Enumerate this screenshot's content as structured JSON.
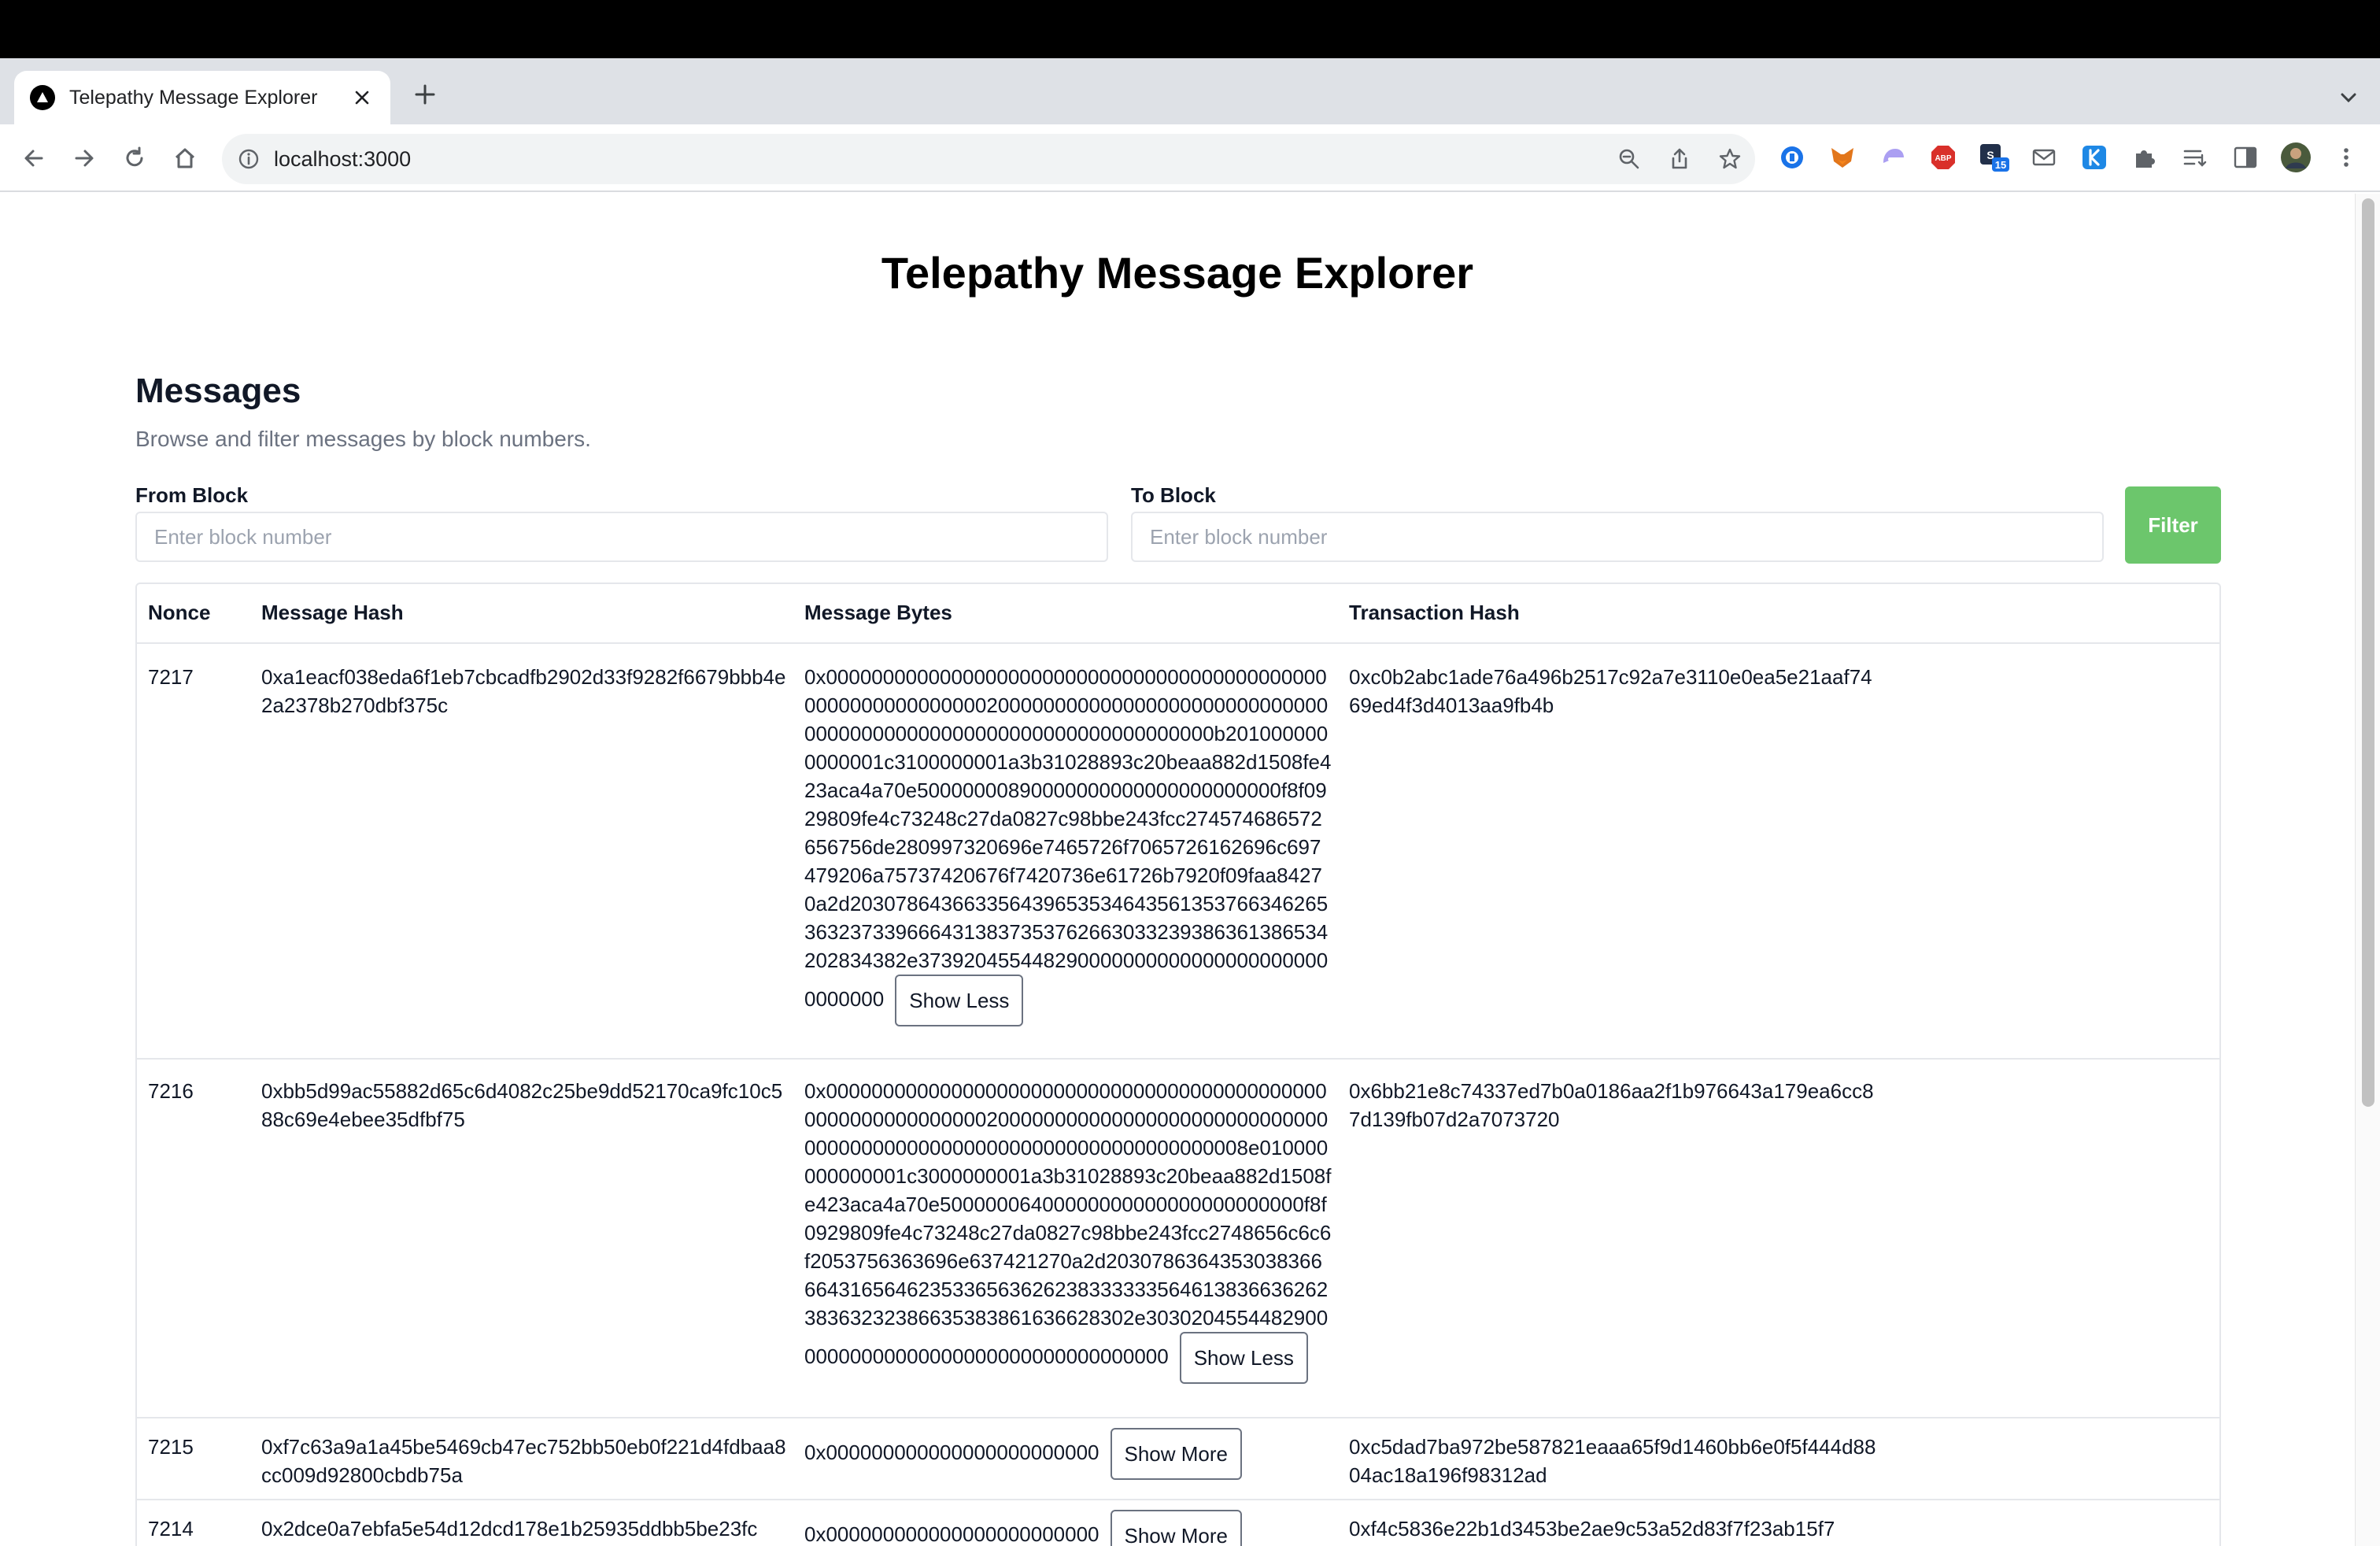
{
  "browser": {
    "tab_title": "Telepathy Message Explorer",
    "url": "localhost:3000",
    "extension_badge": "15"
  },
  "page": {
    "title": "Telepathy Message Explorer",
    "section_title": "Messages",
    "section_subtitle": "Browse and filter messages by block numbers.",
    "from_block": {
      "label": "From Block",
      "placeholder": "Enter block number",
      "value": ""
    },
    "to_block": {
      "label": "To Block",
      "placeholder": "Enter block number",
      "value": ""
    },
    "filter_label": "Filter"
  },
  "table": {
    "headers": [
      "Nonce",
      "Message Hash",
      "Message Bytes",
      "Transaction Hash"
    ],
    "rows": [
      {
        "nonce": "7217",
        "message_hash": "0xa1eacf038eda6f1eb7cbcadfb2902d33f9282f6679bbb4e2a2378b270dbf375c",
        "message_bytes": "0x000000000000000000000000000000000000000000000000000000000000200000000000000000000000000000000000000000000000000000000000000000b2010000000000001c3100000001a3b31028893c20beaa882d1508fe423aca4a70e50000000890000000000000000000000f8f0929809fe4c73248c27da0827c98bbe243fcc274574686572656756de280997320696e7465726f7065726162696c697479206a75737420676f7420736e61726b7920f09faa84270a2d2030786436633564396535346435613537663462653632373396664313837353762663033239386361386534202834382e3739204554482900000000000000000000000000000",
        "toggle_label": "Show Less"
      },
      {
        "nonce": "7216",
        "message_hash": "0xbb5d99ac55882d65c6d4082c25be9dd52170ca9fc10c588c69e4ebee35dfbf75",
        "message_bytes": "0x000000000000000000000000000000000000000000000000000000000000200000000000000000000000000000000000000000000000000000000000000000008e010000000000001c3000000001a3b31028893c20beaa882d1508fe423aca4a70e50000006400000000000000000000000f8f0929809fe4c73248c27da0827c98bbe243fcc2748656c6c6f2053756363696e637421270a2d2030786364353038366664316564623533656362623833333356461383663626238363232386635383861636628302e303020455448290000000000000000000000000000000000",
        "toggle_label": "Show Less"
      },
      {
        "nonce": "7215",
        "message_hash": "0xf7c63a9a1a45be5469cb47ec752bb50eb0f221d4fdbaa8cc009d92800cbdb75a",
        "message_bytes": "0x000000000000000000000000",
        "toggle_label": "Show More",
        "tx_hash": "0xc5dad7ba972be587821eaaa65f9d1460bb6e0f5f444d8804ac18a196f98312ad"
      },
      {
        "nonce": "7214",
        "message_hash": "0x2dce0a7ebfa5e54d12dcd178e1b25935ddbb5be23fc",
        "message_bytes": "0x000000000000000000000000",
        "toggle_label": "Show More",
        "tx_hash": "0xf4c5836e22b1d3453be2ae9c53a52d83f7f23ab15f7"
      }
    ],
    "tx_hashes": [
      "0xc0b2abc1ade76a496b2517c92a7e3110e0ea5e21aaf7469ed4f3d4013aa9fb4b",
      "0x6bb21e8c74337ed7b0a0186aa2f1b976643a179ea6cc87d139fb07d2a7073720"
    ]
  }
}
